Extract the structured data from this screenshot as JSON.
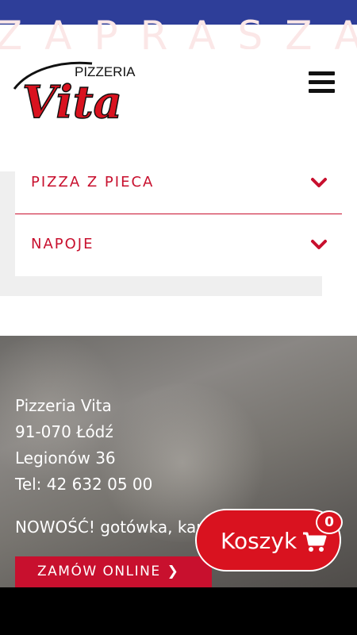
{
  "header": {
    "watermark_text": "ZAPRASZAMY",
    "logo": {
      "small_text": "PIZZERIA",
      "big_text": "Vita"
    },
    "menu_icon": "hamburger-icon"
  },
  "menu": {
    "items": [
      {
        "label": "PIZZA Z PIECA",
        "icon": "chevron-down-icon"
      },
      {
        "label": "NAPOJE",
        "icon": "chevron-down-icon"
      }
    ]
  },
  "footer": {
    "name": "Pizzeria Vita",
    "postal": "91-070 Łódź",
    "street": "Legionów 36",
    "phone": "Tel: 42 632 05 00",
    "notice": "NOWOŚĆ! gotówka, karta",
    "order_button": "ZAMÓW ONLINE"
  },
  "cart": {
    "label": "Koszyk",
    "count": "0",
    "icon": "cart-icon"
  },
  "colors": {
    "accent": "#c8102e",
    "topbar": "#2e3e99",
    "cart": "#d9121f"
  }
}
